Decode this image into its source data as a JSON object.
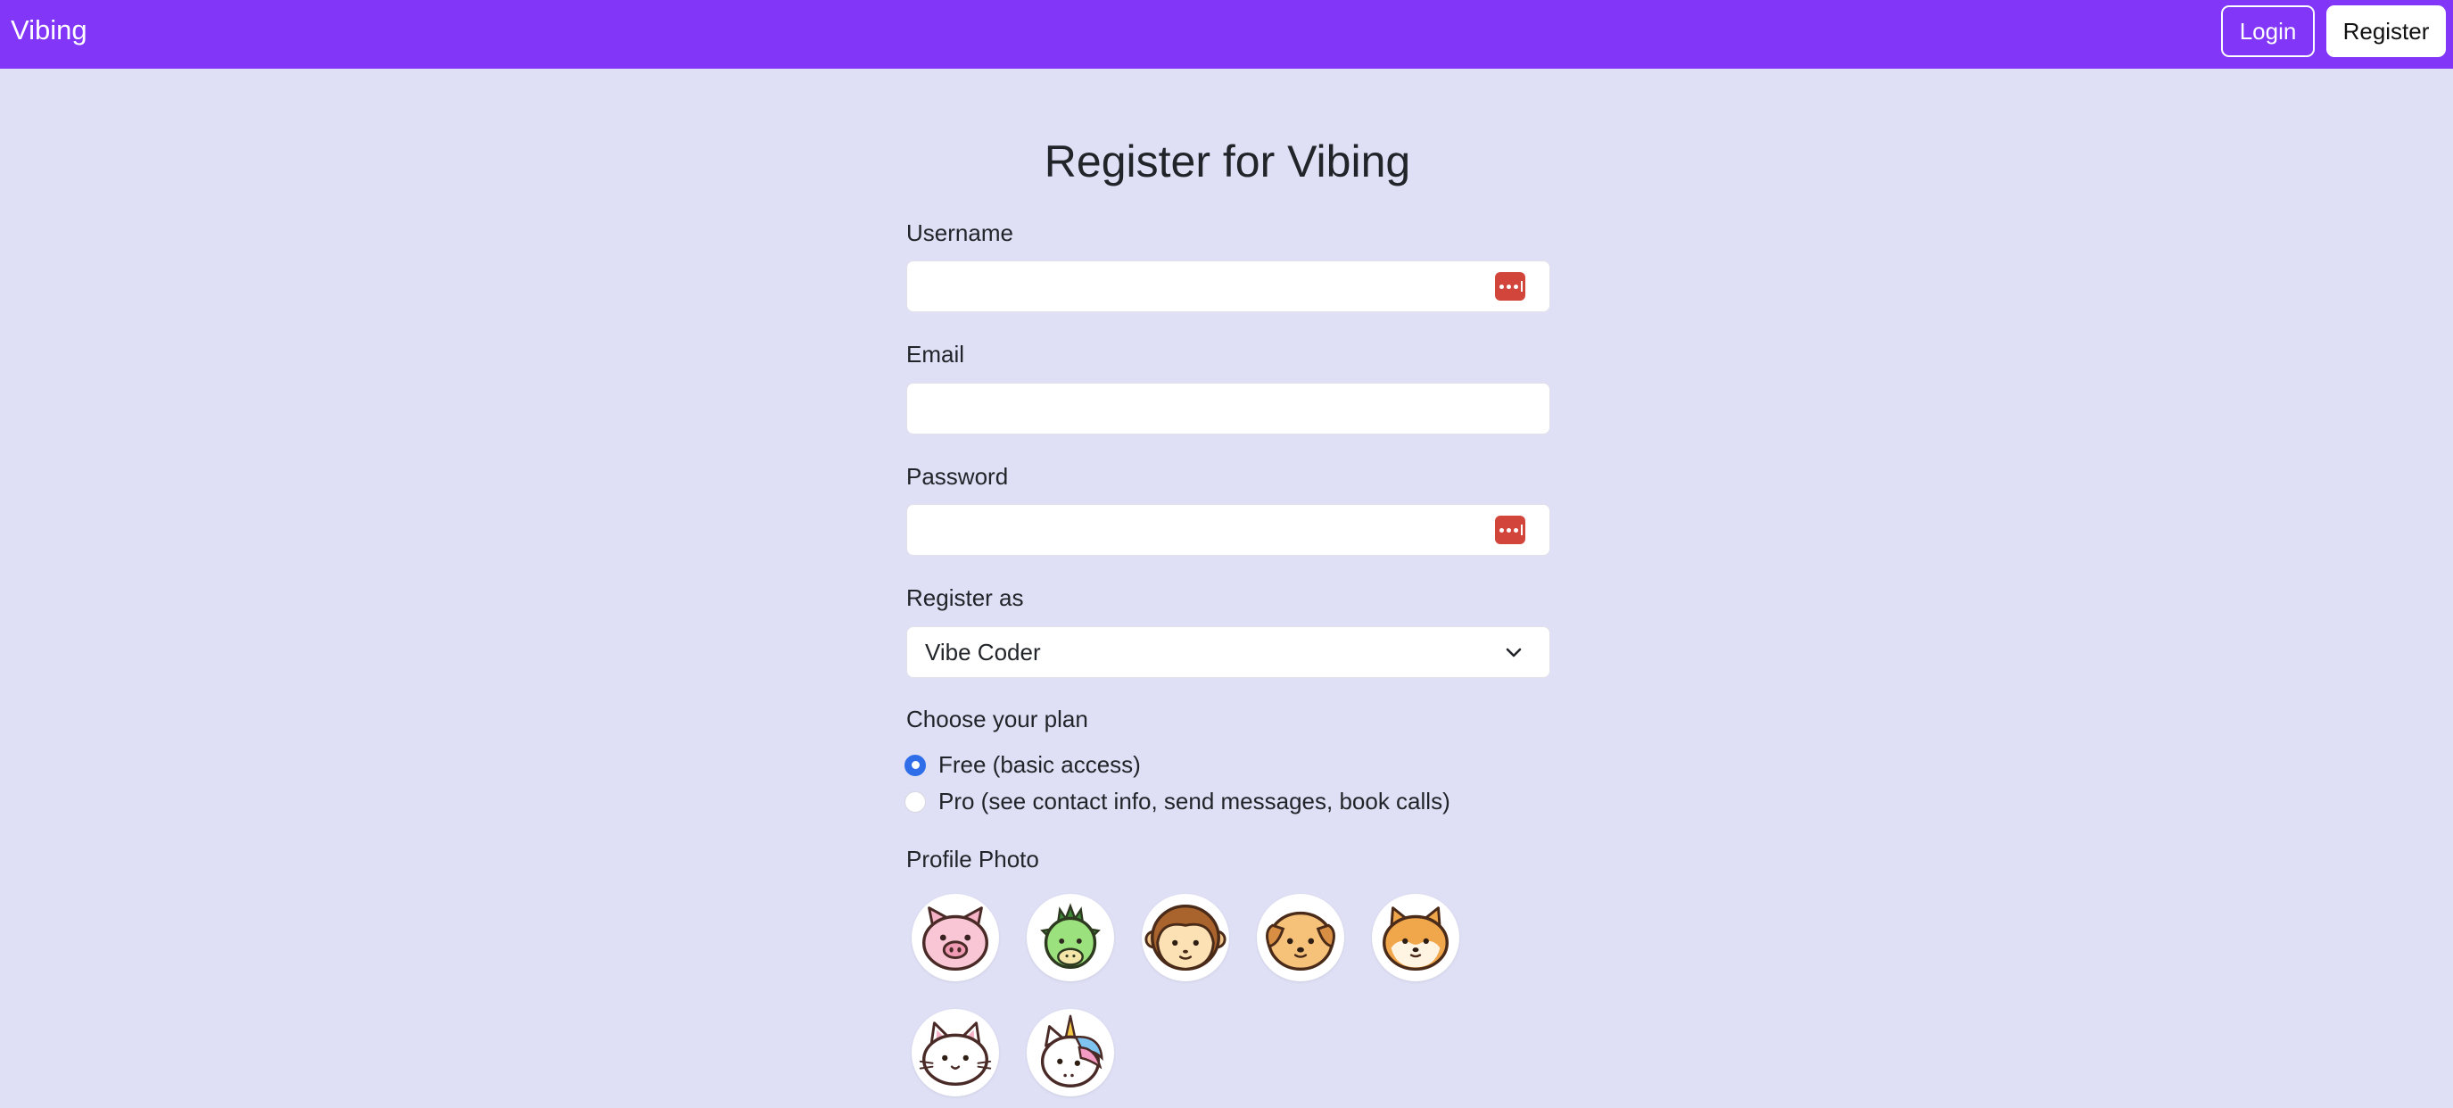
{
  "navbar": {
    "brand": "Vibing",
    "login_label": "Login",
    "register_label": "Register",
    "bg_color": "#8236f8"
  },
  "form": {
    "title": "Register for Vibing",
    "username": {
      "label": "Username",
      "value": "",
      "placeholder": ""
    },
    "email": {
      "label": "Email",
      "value": "",
      "placeholder": ""
    },
    "password": {
      "label": "Password",
      "value": "",
      "placeholder": ""
    },
    "role": {
      "label": "Register as",
      "selected": "Vibe Coder"
    },
    "plan": {
      "label": "Choose your plan",
      "options": [
        {
          "label": "Free (basic access)",
          "checked": true
        },
        {
          "label": "Pro (see contact info, send messages, book calls)",
          "checked": false
        }
      ]
    },
    "profile_photo": {
      "label": "Profile Photo",
      "avatars": [
        "pig-avatar",
        "dragon-avatar",
        "monkey-avatar",
        "dog-avatar",
        "shiba-avatar",
        "cat-avatar",
        "unicorn-avatar"
      ]
    }
  },
  "icons": {
    "password_manager": "password-manager-icon",
    "select_chevron": "chevron-down-icon"
  }
}
